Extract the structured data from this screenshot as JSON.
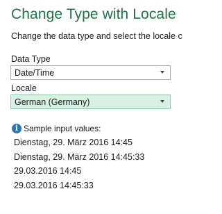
{
  "dialog": {
    "title": "Change Type with Locale",
    "subtitle": "Change the data type and select the locale c"
  },
  "data_type": {
    "label": "Data Type",
    "value": "Date/Time"
  },
  "locale": {
    "label": "Locale",
    "value": "German (Germany)"
  },
  "samples": {
    "icon": "info-icon",
    "icon_glyph": "i",
    "header": "Sample input values:",
    "values": [
      "Dienstag, 29. März 2016 14:45",
      "Dienstag, 29. März 2016 14:45:33",
      "29.03.2016 14:45",
      "29.03.2016 14:45:33"
    ]
  },
  "colors": {
    "title": "#217346",
    "locale_highlight": "#d8f0e3",
    "info_icon": "#2b74b8"
  }
}
